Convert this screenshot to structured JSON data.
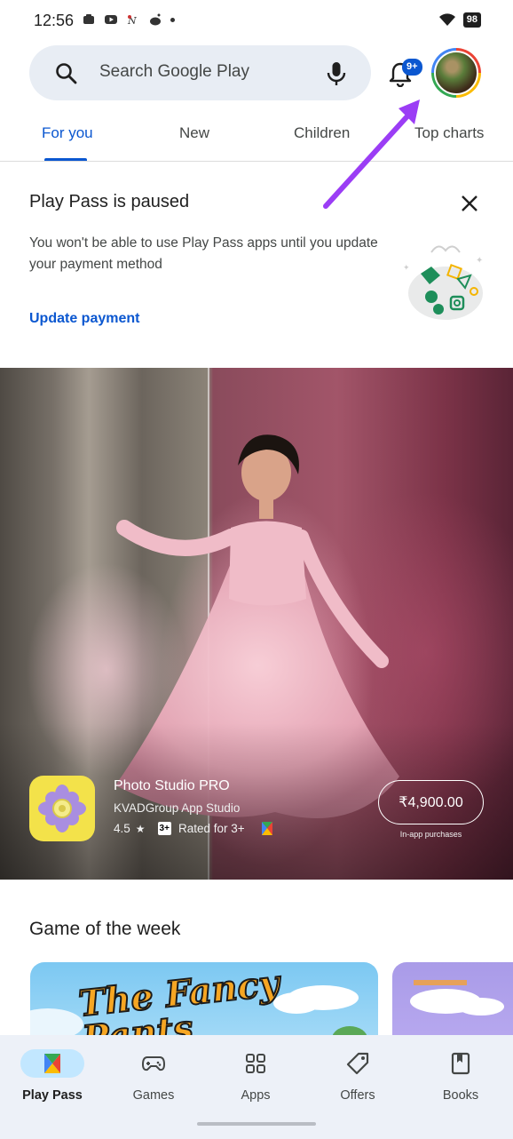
{
  "status_bar": {
    "time": "12:56",
    "battery": "98"
  },
  "search": {
    "placeholder": "Search Google Play"
  },
  "notifications": {
    "badge": "9+"
  },
  "tabs": [
    {
      "label": "For you",
      "active": true
    },
    {
      "label": "New",
      "active": false
    },
    {
      "label": "Children",
      "active": false
    },
    {
      "label": "Top charts",
      "active": false
    }
  ],
  "play_pass_card": {
    "title": "Play Pass is paused",
    "description": "You won't be able to use Play Pass apps until you update your payment method",
    "action_label": "Update payment"
  },
  "featured_app": {
    "name": "Photo Studio PRO",
    "developer": "KVADGroup App Studio",
    "rating": "4.5",
    "age_badge": "3+",
    "age_rating_text": "Rated for 3+",
    "price": "₹4,900.00",
    "price_note": "In-app purchases"
  },
  "game_of_week": {
    "title": "Game of the week",
    "game_logo_text": "The Fancy Pants"
  },
  "bottom_nav": [
    {
      "label": "Play Pass",
      "icon": "play-pass-icon",
      "active": true
    },
    {
      "label": "Games",
      "icon": "gamepad-icon",
      "active": false
    },
    {
      "label": "Apps",
      "icon": "apps-grid-icon",
      "active": false
    },
    {
      "label": "Offers",
      "icon": "tag-icon",
      "active": false
    },
    {
      "label": "Books",
      "icon": "bookmark-icon",
      "active": false
    }
  ],
  "colors": {
    "accent": "#0b57d0",
    "nav_active_pill": "#c2e7ff",
    "annotation_arrow": "#9b3df5"
  }
}
